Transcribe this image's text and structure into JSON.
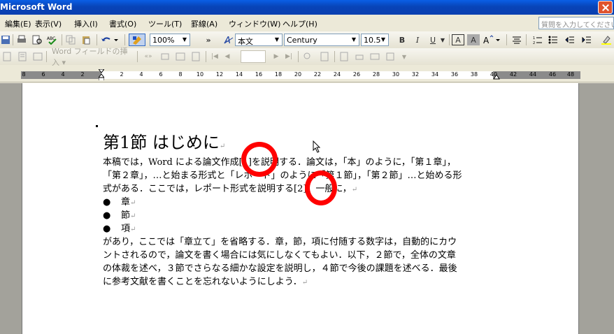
{
  "window": {
    "title": "Microsoft Word"
  },
  "menu": {
    "items": [
      "編集(E)",
      "表示(V)",
      "挿入(I)",
      "書式(O)",
      "ツール(T)",
      "罫線(A)",
      "ウィンドウ(W)",
      "ヘルプ(H)"
    ]
  },
  "help_search": {
    "placeholder": "質問を入力してください"
  },
  "toolbar1": {
    "zoom": "100%",
    "style": "本文",
    "font": "Century",
    "size": "10.5",
    "bold": "B",
    "italic": "I",
    "underline": "U",
    "border_char": "A",
    "shade_char": "A",
    "more": "»"
  },
  "toolbar2": {
    "field_insert": "Word フィールドの挿入 ▾",
    "abc": "«»"
  },
  "ruler": {
    "ticks": [
      "8",
      "6",
      "4",
      "2",
      "2",
      "4",
      "6",
      "8",
      "10",
      "12",
      "14",
      "16",
      "18",
      "20",
      "22",
      "24",
      "26",
      "28",
      "30",
      "32",
      "34",
      "36",
      "38",
      "40",
      "42",
      "44",
      "46",
      "48"
    ]
  },
  "document": {
    "heading": "第1節 はじめに",
    "paragraph_lines": [
      "本稿では，Word による論文作成[1]を説明する．論文は，「本」のように，「第１章」，",
      "「第２章」，…と始まる形式と「レポート」のように「第１節」，「第２節」…と始める形",
      "式がある．ここでは，レポート形式を説明する[2]．一般に，"
    ],
    "bullets": [
      "章",
      "節",
      "項"
    ],
    "paragraph2_lines": [
      "があり，ここでは「章立て」を省略する．章，節，項に付随する数字は，自動的にカウ",
      "ントされるので，論文を書く場合には気にしなくてもよい．以下，２節で，全体の文章",
      "の体裁を述べ，３節でさらなる細かな設定を説明し，４節で今後の課題を述べる．最後",
      "に参考文献を書くことを忘れないようにしよう．"
    ],
    "paragraph_mark": "↵",
    "bullet_char": "●"
  },
  "colors": {
    "annotation": "#ff0000",
    "titlebar": "#0a5fe6"
  }
}
